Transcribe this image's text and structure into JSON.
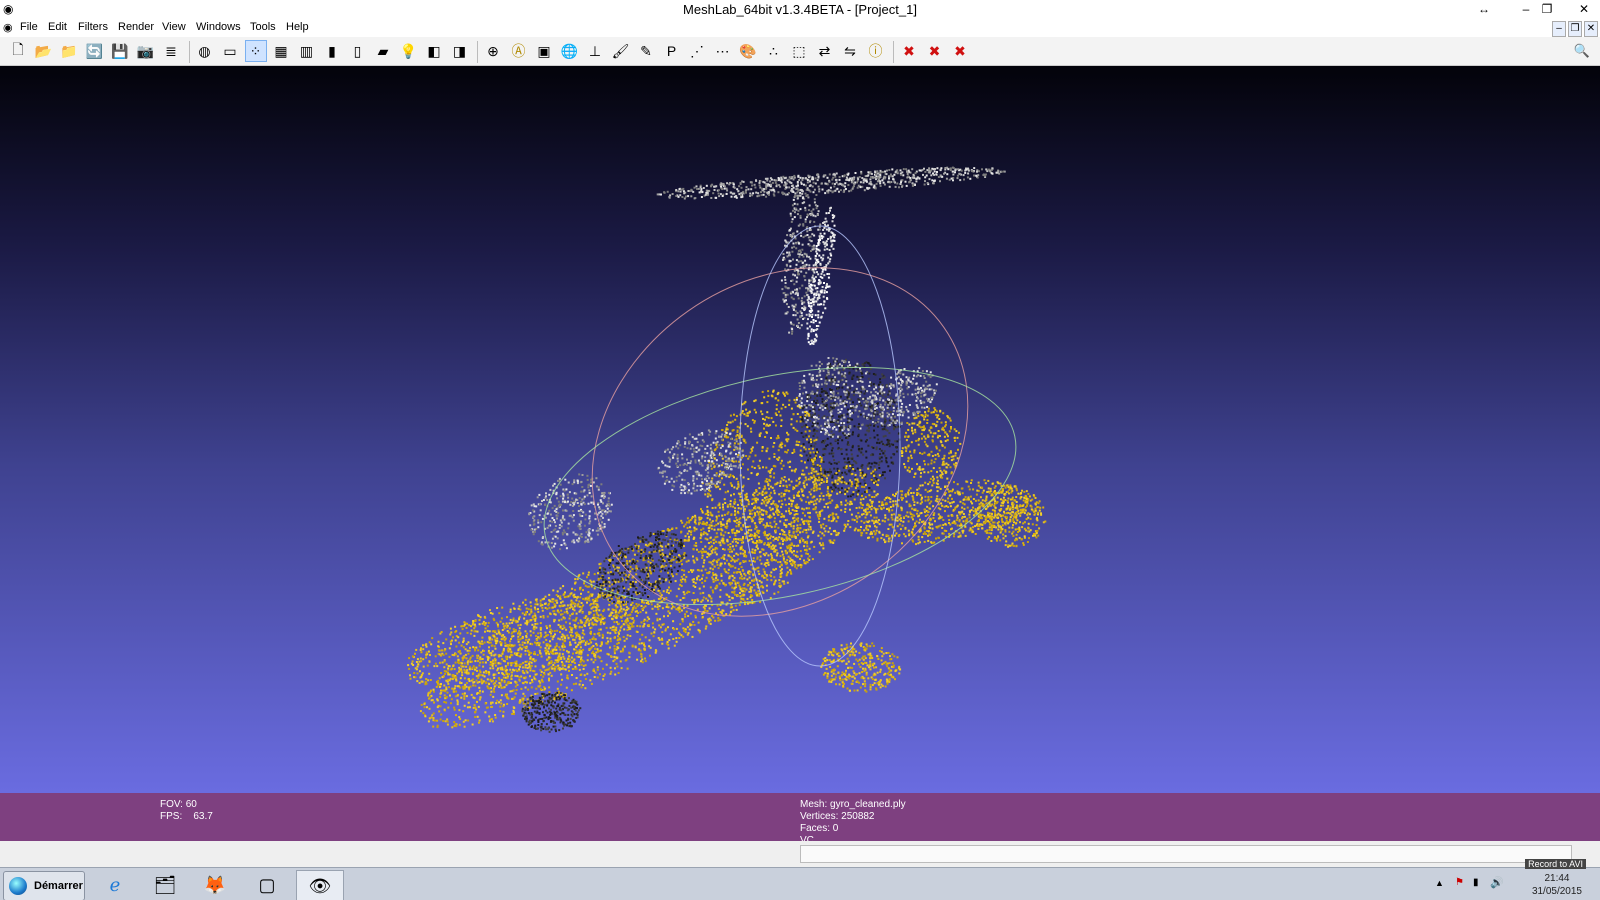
{
  "window": {
    "title": "MeshLab_64bit v1.3.4BETA - [Project_1]",
    "buttons": {
      "resize": "↔",
      "minimize": "–",
      "restore": "❐",
      "close": "✕"
    },
    "mdi_buttons": {
      "minimize": "–",
      "restore": "❐",
      "close": "✕"
    }
  },
  "menu": [
    "File",
    "Edit",
    "Filters",
    "Render",
    "View",
    "Windows",
    "Tools",
    "Help"
  ],
  "toolbar": {
    "icons": [
      {
        "name": "new-project-icon",
        "glyph": "🗋"
      },
      {
        "name": "open-project-icon",
        "glyph": "📂"
      },
      {
        "name": "import-mesh-icon",
        "glyph": "📁"
      },
      {
        "name": "reload-icon",
        "glyph": "🔄"
      },
      {
        "name": "save-icon",
        "glyph": "💾"
      },
      {
        "name": "snapshot-icon",
        "glyph": "📷"
      },
      {
        "name": "layers-icon",
        "glyph": "≣"
      },
      {
        "name": "shading-icon",
        "glyph": "◍"
      },
      {
        "name": "bbox-icon",
        "glyph": "▭"
      },
      {
        "name": "points-icon",
        "glyph": "⁘"
      },
      {
        "name": "wireframe-icon",
        "glyph": "▦"
      },
      {
        "name": "hidden-lines-icon",
        "glyph": "▥"
      },
      {
        "name": "flat-icon",
        "glyph": "▮"
      },
      {
        "name": "flat-lines-icon",
        "glyph": "▯"
      },
      {
        "name": "smooth-icon",
        "glyph": "▰"
      },
      {
        "name": "lighting-icon",
        "glyph": "💡"
      },
      {
        "name": "back-face-icon",
        "glyph": "◧"
      },
      {
        "name": "texture-icon",
        "glyph": "◨"
      },
      {
        "name": "trackball-icon",
        "glyph": "⊕"
      },
      {
        "name": "annotation-icon",
        "glyph": "Ⓐ"
      },
      {
        "name": "raster-icon",
        "glyph": "▣"
      },
      {
        "name": "globe-icon",
        "glyph": "🌐"
      },
      {
        "name": "axis-icon",
        "glyph": "⊥"
      },
      {
        "name": "paint-icon",
        "glyph": "🖌"
      },
      {
        "name": "brush-icon",
        "glyph": "✎"
      },
      {
        "name": "pick-points-icon",
        "glyph": "P"
      },
      {
        "name": "select-vertices-icon",
        "glyph": "⋰"
      },
      {
        "name": "select-faces-icon",
        "glyph": "⋯"
      },
      {
        "name": "color-icon",
        "glyph": "🎨"
      },
      {
        "name": "reference-icon",
        "glyph": "∴"
      },
      {
        "name": "select-region-icon",
        "glyph": "⬚"
      },
      {
        "name": "align-icon",
        "glyph": "⇄"
      },
      {
        "name": "measure-icon",
        "glyph": "⇋"
      },
      {
        "name": "info-icon",
        "glyph": "ⓘ"
      },
      {
        "name": "delete-vertices-icon",
        "glyph": "✖"
      },
      {
        "name": "delete-faces-icon",
        "glyph": "✖"
      },
      {
        "name": "delete-all-icon",
        "glyph": "✖"
      }
    ],
    "search": "🔍"
  },
  "info": {
    "fov": "FOV: 60",
    "fps": "FPS:    63.7",
    "mesh": "Mesh: gyro_cleaned.ply",
    "vertices": "Vertices: 250882",
    "faces": "Faces: 0",
    "vc": "VC"
  },
  "taskbar": {
    "start_label": "Démarrer",
    "apps": [
      {
        "name": "internet-explorer-icon",
        "glyph": "ℯ"
      },
      {
        "name": "file-explorer-icon",
        "glyph": "🗂"
      },
      {
        "name": "firefox-icon",
        "glyph": "🦊"
      },
      {
        "name": "window-app-icon",
        "glyph": "▢"
      },
      {
        "name": "meshlab-app-icon",
        "glyph": "👁"
      }
    ],
    "record_label": "Record to AVI",
    "time": "21:44",
    "date": "31/05/2015"
  },
  "colors": {
    "viewport_top": "#03030a",
    "viewport_bottom": "#6a6ce0",
    "info_bar": "#7e4080",
    "model_yellow": "#e9c21c"
  }
}
